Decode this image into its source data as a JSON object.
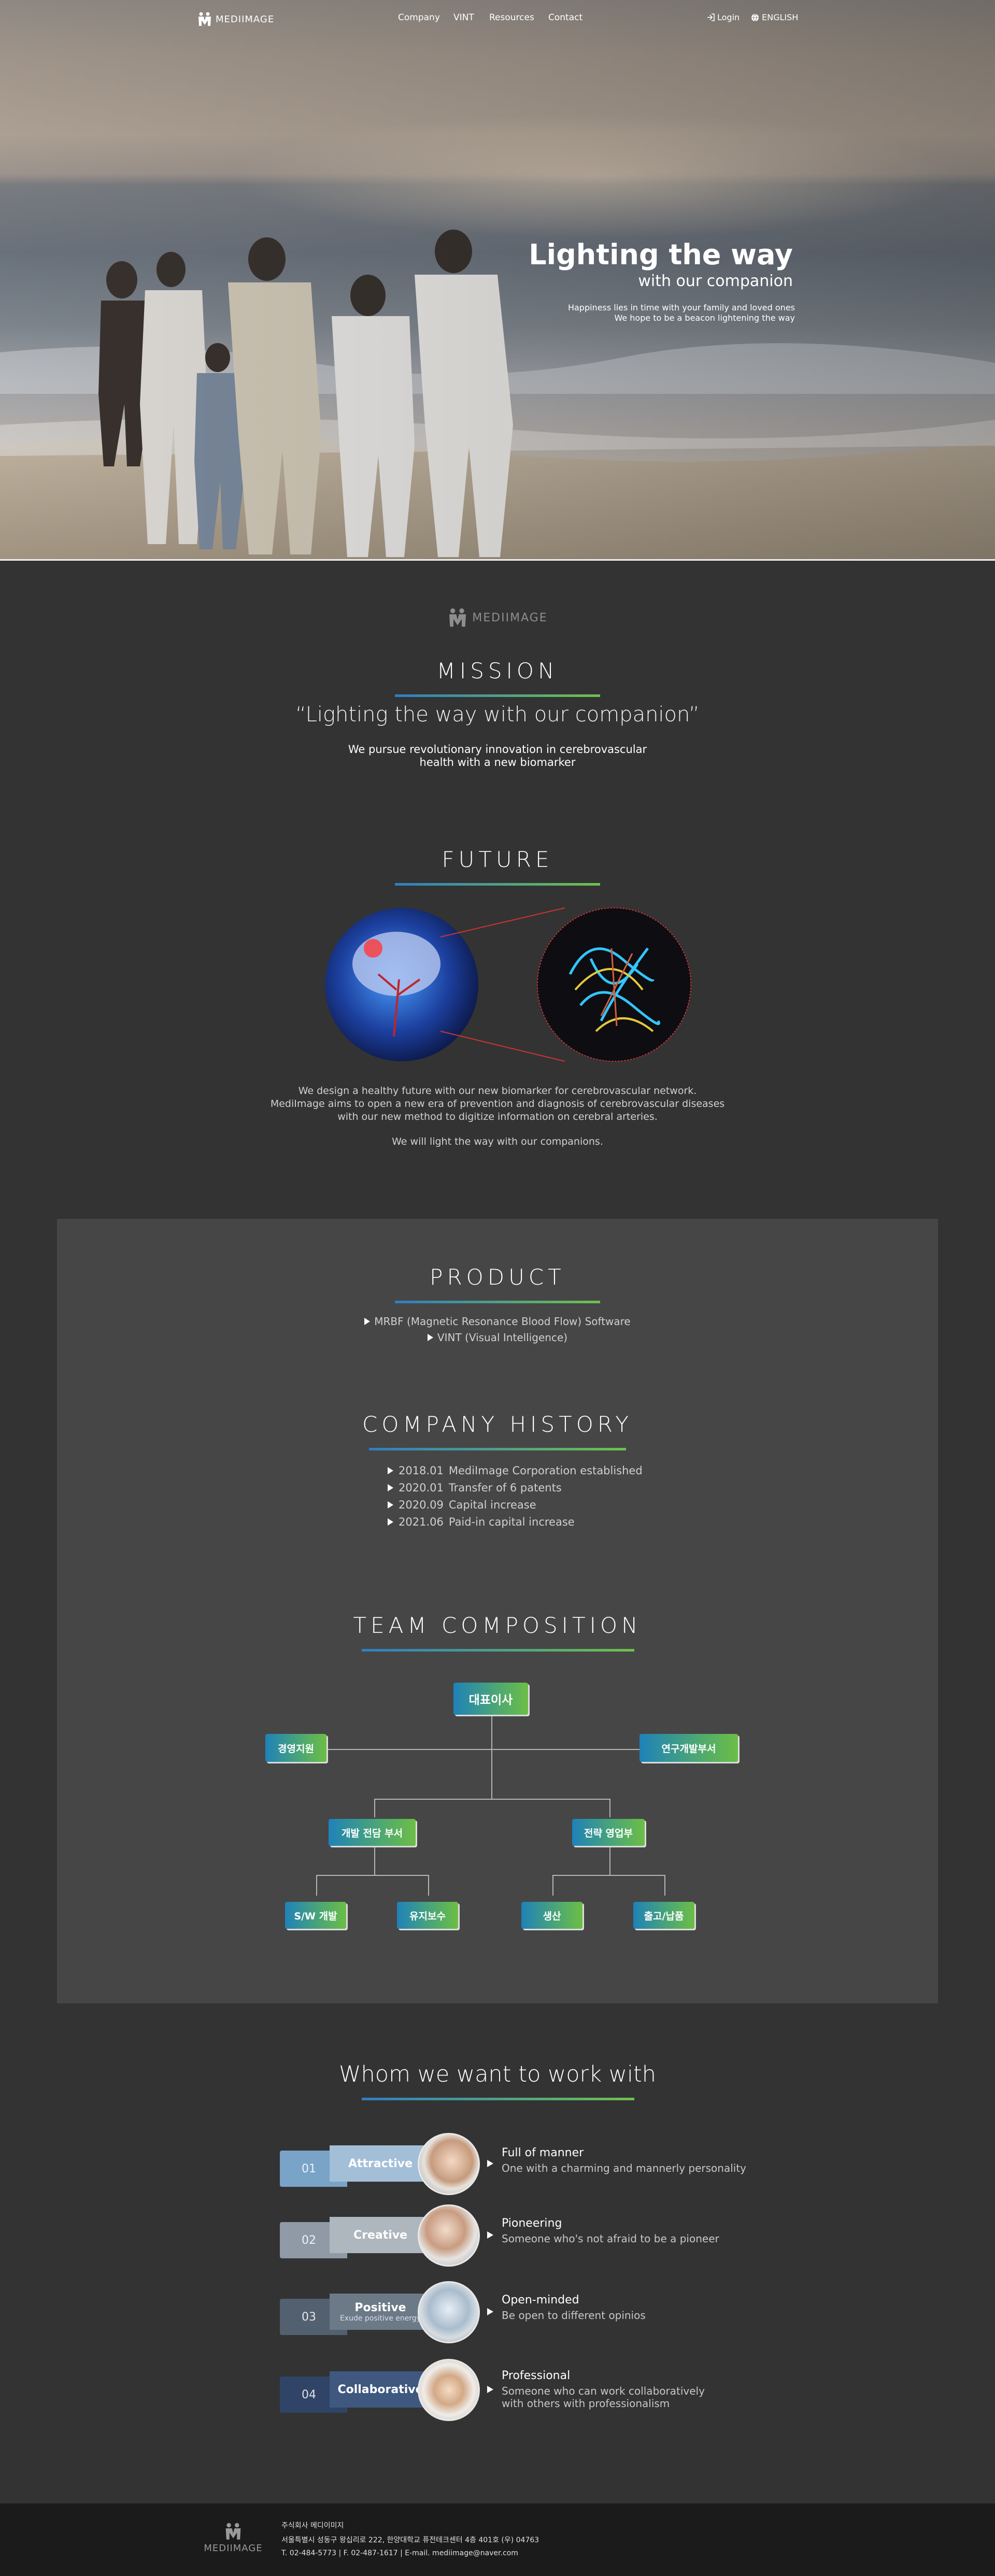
{
  "header": {
    "logo_text": "MEDIIMAGE",
    "nav": [
      "Company",
      "VINT",
      "Resources",
      "Contact"
    ],
    "login": "Login",
    "language": "ENGLISH"
  },
  "hero": {
    "title": "Lighting the way",
    "subtitle": "with our companion",
    "line1": "Happiness lies in time with your family and loved ones",
    "line2": "We hope to be a beacon lightening the way"
  },
  "mission": {
    "logo_text": "MEDIIMAGE",
    "title": "MISSION",
    "quote": "“Lighting the way with our companion”",
    "text1": "We pursue revolutionary innovation in cerebrovascular",
    "text2": "health with a new biomarker"
  },
  "future": {
    "title": "FUTURE",
    "p1": "We design a healthy future with our new biomarker for cerebrovascular network.",
    "p2": "MediImage aims to open a new era of prevention and diagnosis of cerebrovascular diseases",
    "p3": "with our new method to digitize information on cerebral arteries.",
    "p4": "We will light the way with our companions."
  },
  "product": {
    "title": "PRODUCT",
    "item1_html": "MRBF (Magnetic Resonance Blood Flow) Software",
    "item2_html": "VINT (Visual Intelligence)"
  },
  "history": {
    "title": "COMPANY HISTORY",
    "items": [
      {
        "date": "2018.01",
        "text": "MediImage Corporation established"
      },
      {
        "date": "2020.01",
        "text": "Transfer of 6 patents"
      },
      {
        "date": "2020.09",
        "text": "Capital increase"
      },
      {
        "date": "2021.06",
        "text": "Paid-in capital increase"
      }
    ]
  },
  "team": {
    "title": "TEAM COMPOSITION",
    "ceo": "대표이사",
    "mgmt": "경영지원",
    "rnd": "연구개발부서",
    "dev": "개발 전담 부서",
    "strategy": "전략 영업부",
    "sw": "S/W 개발",
    "maint": "유지보수",
    "prod": "생산",
    "ship": "출고/납품"
  },
  "whom": {
    "title": "Whom we want to work with",
    "items": [
      {
        "num": "01",
        "label": "Attractive",
        "sub": "",
        "title": "Full of manner",
        "desc1": "One with a charming and mannerly personality",
        "desc2": ""
      },
      {
        "num": "02",
        "label": "Creative",
        "sub": "",
        "title": "Pioneering",
        "desc1": "Someone who's not afraid to be a pioneer",
        "desc2": ""
      },
      {
        "num": "03",
        "label": "Positive",
        "sub": "Exude positive energy",
        "title": "Open-minded",
        "desc1": "Be open to different opinios",
        "desc2": ""
      },
      {
        "num": "04",
        "label": "Collaborative",
        "sub": "",
        "title": "Professional",
        "desc1": "Someone who can work collaboratively",
        "desc2": "with others with professionalism"
      }
    ]
  },
  "footer": {
    "logo_text": "MEDIIMAGE",
    "company": "주식회사 메디이미지",
    "address": "서울특별시 성동구 왕십리로 222, 한양대학교 퓨전테크센터 4층 401호 (우) 04763",
    "contact": "T. 02-484-5773 | F. 02-487-1617 | E-mail. mediimage@naver.com"
  },
  "colors": {
    "bg": "#333333",
    "panel": "#464646",
    "accent_blue": "#2f7ec4",
    "accent_green": "#6ec24a"
  }
}
